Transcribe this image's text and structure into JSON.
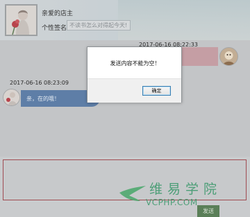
{
  "profile": {
    "nickname": "亲爱的店主",
    "sign_label": "个性签名：",
    "sign_value": "不读书怎么对得起今天!"
  },
  "chat": {
    "messages": [
      {
        "time": "2017-06-16 08:22:33",
        "side": "right",
        "text": ""
      },
      {
        "time": "2017-06-16 08:23:09",
        "side": "left",
        "text": "亲，在的哦！"
      }
    ]
  },
  "compose": {
    "value": ""
  },
  "send": {
    "label": "发送"
  },
  "alert": {
    "message": "发送内容不能为空！",
    "ok_label": "确定"
  },
  "watermark": {
    "cn": "维易学院",
    "en": "VCPHP.COM"
  },
  "colors": {
    "compose_border": "#a04c52",
    "right_bubble": "#c59ea4",
    "left_bubble": "#5e7ea7",
    "send_button": "#5a7f58",
    "watermark": "#3f9a6e",
    "alert_ok_border": "#3c7fb1"
  }
}
